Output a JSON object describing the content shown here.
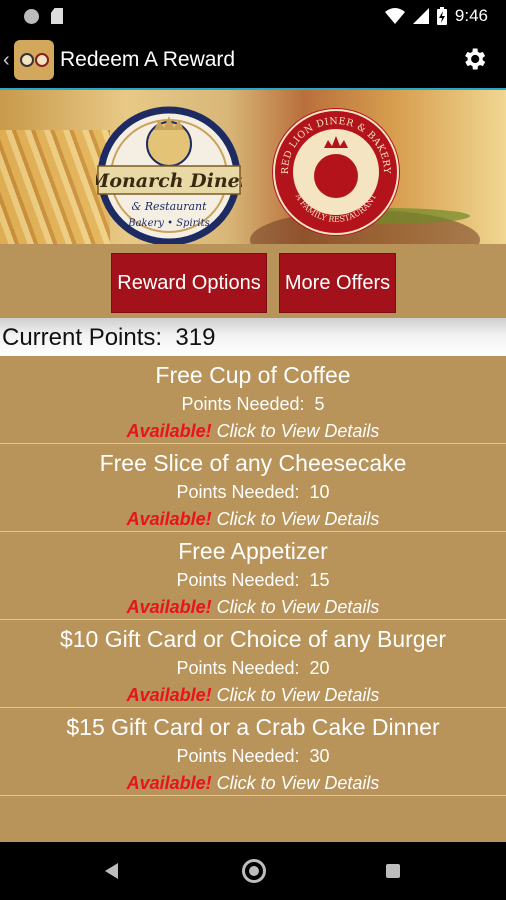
{
  "status_bar": {
    "time": "9:46",
    "icons": [
      "notification-dot-icon",
      "sd-card-icon",
      "wifi-icon",
      "signal-icon",
      "battery-charging-icon"
    ]
  },
  "app_bar": {
    "title": "Redeem A Reward",
    "logo_icon": "restaurant-logo-icon",
    "settings_icon": "gear-icon"
  },
  "hero": {
    "monarch_logo": {
      "name": "Monarch Diner",
      "sub": "& Restaurant",
      "tagline": "Bakery • Spirits"
    },
    "redlion_logo": {
      "ring_text": "RED LION DINER & BAKERY",
      "bottom_text": "A FAMILY RESTAURANT"
    }
  },
  "buttons": {
    "reward_options": "Reward Options",
    "more_offers": "More Offers"
  },
  "points": {
    "label": "Current Points:  319"
  },
  "rewards": [
    {
      "title": "Free Cup of Coffee",
      "points_text": "Points Needed:  5",
      "status": "Available!",
      "details": "Click to View Details"
    },
    {
      "title": "Free Slice of any Cheesecake",
      "points_text": "Points Needed:  10",
      "status": "Available!",
      "details": "Click to View Details"
    },
    {
      "title": "Free Appetizer",
      "points_text": "Points Needed:  15",
      "status": "Available!",
      "details": "Click to View Details"
    },
    {
      "title": "$10 Gift Card or Choice of any Burger",
      "points_text": "Points Needed:  20",
      "status": "Available!",
      "details": "Click to View Details"
    },
    {
      "title": "$15 Gift Card or a Crab Cake Dinner",
      "points_text": "Points Needed:  30",
      "status": "Available!",
      "details": "Click to View Details"
    }
  ],
  "colors": {
    "brand_red": "#a3121a",
    "list_background": "#b8935a",
    "available_red": "#e8131b",
    "accent_line": "#29a8c9"
  },
  "nav_bar": {
    "icons": [
      "back-triangle-icon",
      "home-circle-icon",
      "recents-square-icon"
    ]
  }
}
